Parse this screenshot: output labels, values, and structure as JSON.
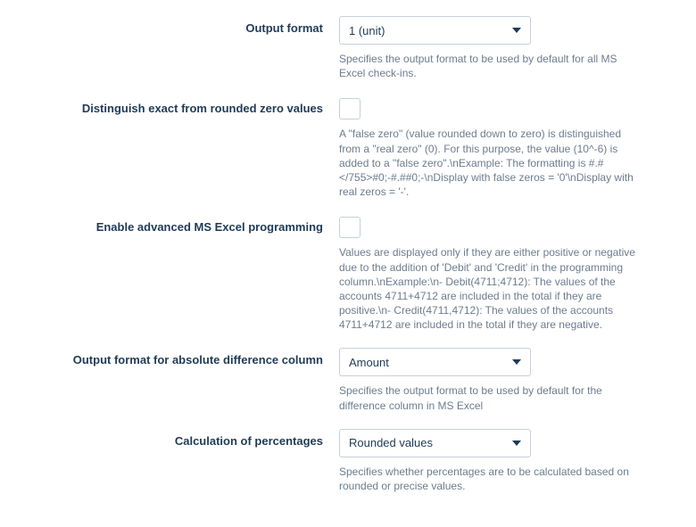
{
  "fields": {
    "output_format": {
      "label": "Output format",
      "value": "1 (unit)",
      "help": "Specifies the output format to be used by default for all MS Excel check-ins."
    },
    "distinguish_zero": {
      "label": "Distinguish exact from rounded zero values",
      "help": "A \"false zero\" (value rounded down to zero) is distinguished from a \"real zero\" (0). For this purpose, the value (10^-6) is added to a \"false zero\".\\nExample: The formatting is #.#</755>#0;-#.##0;-\\nDisplay with false zeros = '0'\\nDisplay with real zeros = '-'."
    },
    "enable_advanced": {
      "label": "Enable advanced MS Excel programming",
      "help": "Values are displayed only if they are either positive or negative due to the addition of 'Debit' and 'Credit' in the programming column.\\nExample:\\n- Debit(4711;4712): The values of the accounts 4711+4712 are included in the total if they are positive.\\n- Credit(4711,4712): The values of the accounts 4711+4712 are included in the total if they are negative."
    },
    "abs_diff_format": {
      "label": "Output format for absolute difference column",
      "value": "Amount",
      "help": "Specifies the output format to be used by default for the difference column in MS Excel"
    },
    "calc_percent": {
      "label": "Calculation of percentages",
      "value": "Rounded values",
      "help": "Specifies whether percentages are to be calculated based on rounded or precise values."
    }
  }
}
